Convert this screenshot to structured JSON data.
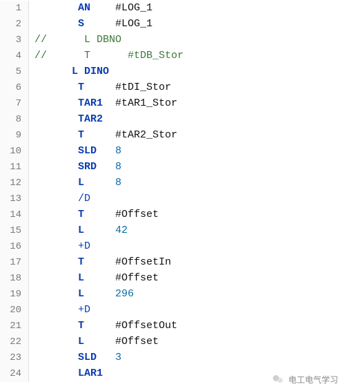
{
  "editor": {
    "lines": [
      {
        "n": 1,
        "comment": false,
        "indent": "a",
        "op": "AN",
        "op_cls": "c-kw",
        "arg": "#LOG_1",
        "arg_cls": "c-ident"
      },
      {
        "n": 2,
        "comment": false,
        "indent": "a",
        "op": "S",
        "op_cls": "c-kw",
        "arg": "#LOG_1",
        "arg_cls": "c-ident"
      },
      {
        "n": 3,
        "comment": true,
        "raw": "//      L DBNO"
      },
      {
        "n": 4,
        "comment": true,
        "raw": "//      T      #tDB_Stor"
      },
      {
        "n": 5,
        "comment": false,
        "indent": "a2",
        "op": "L DINO",
        "op_cls": "c-kw",
        "arg": "",
        "arg_cls": ""
      },
      {
        "n": 6,
        "comment": false,
        "indent": "a",
        "op": "T",
        "op_cls": "c-kw",
        "arg": "#tDI_Stor",
        "arg_cls": "c-ident"
      },
      {
        "n": 7,
        "comment": false,
        "indent": "a",
        "op": "TAR1",
        "op_cls": "c-kw",
        "arg": "#tAR1_Stor",
        "arg_cls": "c-ident"
      },
      {
        "n": 8,
        "comment": false,
        "indent": "a",
        "op": "TAR2",
        "op_cls": "c-kw",
        "arg": "",
        "arg_cls": ""
      },
      {
        "n": 9,
        "comment": false,
        "indent": "a",
        "op": "T",
        "op_cls": "c-kw",
        "arg": "#tAR2_Stor",
        "arg_cls": "c-ident"
      },
      {
        "n": 10,
        "comment": false,
        "indent": "a",
        "op": "SLD",
        "op_cls": "c-kw",
        "arg": "8",
        "arg_cls": "c-num"
      },
      {
        "n": 11,
        "comment": false,
        "indent": "a",
        "op": "SRD",
        "op_cls": "c-kw",
        "arg": "8",
        "arg_cls": "c-num"
      },
      {
        "n": 12,
        "comment": false,
        "indent": "a",
        "op": "L",
        "op_cls": "c-kw",
        "arg": "8",
        "arg_cls": "c-num"
      },
      {
        "n": 13,
        "comment": false,
        "indent": "a",
        "op": "/D",
        "op_cls": "c-op2",
        "arg": "",
        "arg_cls": ""
      },
      {
        "n": 14,
        "comment": false,
        "indent": "a",
        "op": "T",
        "op_cls": "c-kw",
        "arg": "#Offset",
        "arg_cls": "c-ident"
      },
      {
        "n": 15,
        "comment": false,
        "indent": "a",
        "op": "L",
        "op_cls": "c-kw",
        "arg": "42",
        "arg_cls": "c-num"
      },
      {
        "n": 16,
        "comment": false,
        "indent": "a",
        "op": "+D",
        "op_cls": "c-op2",
        "arg": "",
        "arg_cls": ""
      },
      {
        "n": 17,
        "comment": false,
        "indent": "a",
        "op": "T",
        "op_cls": "c-kw",
        "arg": "#OffsetIn",
        "arg_cls": "c-ident"
      },
      {
        "n": 18,
        "comment": false,
        "indent": "a",
        "op": "L",
        "op_cls": "c-kw",
        "arg": "#Offset",
        "arg_cls": "c-ident"
      },
      {
        "n": 19,
        "comment": false,
        "indent": "a",
        "op": "L",
        "op_cls": "c-kw",
        "arg": "296",
        "arg_cls": "c-num"
      },
      {
        "n": 20,
        "comment": false,
        "indent": "a",
        "op": "+D",
        "op_cls": "c-op2",
        "arg": "",
        "arg_cls": ""
      },
      {
        "n": 21,
        "comment": false,
        "indent": "a",
        "op": "T",
        "op_cls": "c-kw",
        "arg": "#OffsetOut",
        "arg_cls": "c-ident"
      },
      {
        "n": 22,
        "comment": false,
        "indent": "a",
        "op": "L",
        "op_cls": "c-kw",
        "arg": "#Offset",
        "arg_cls": "c-ident"
      },
      {
        "n": 23,
        "comment": false,
        "indent": "a",
        "op": "SLD",
        "op_cls": "c-kw",
        "arg": "3",
        "arg_cls": "c-num"
      },
      {
        "n": 24,
        "comment": false,
        "indent": "a",
        "op": "LAR1",
        "op_cls": "c-kw",
        "arg": "",
        "arg_cls": ""
      }
    ]
  },
  "footer": {
    "watermark": "电工电气学习"
  }
}
